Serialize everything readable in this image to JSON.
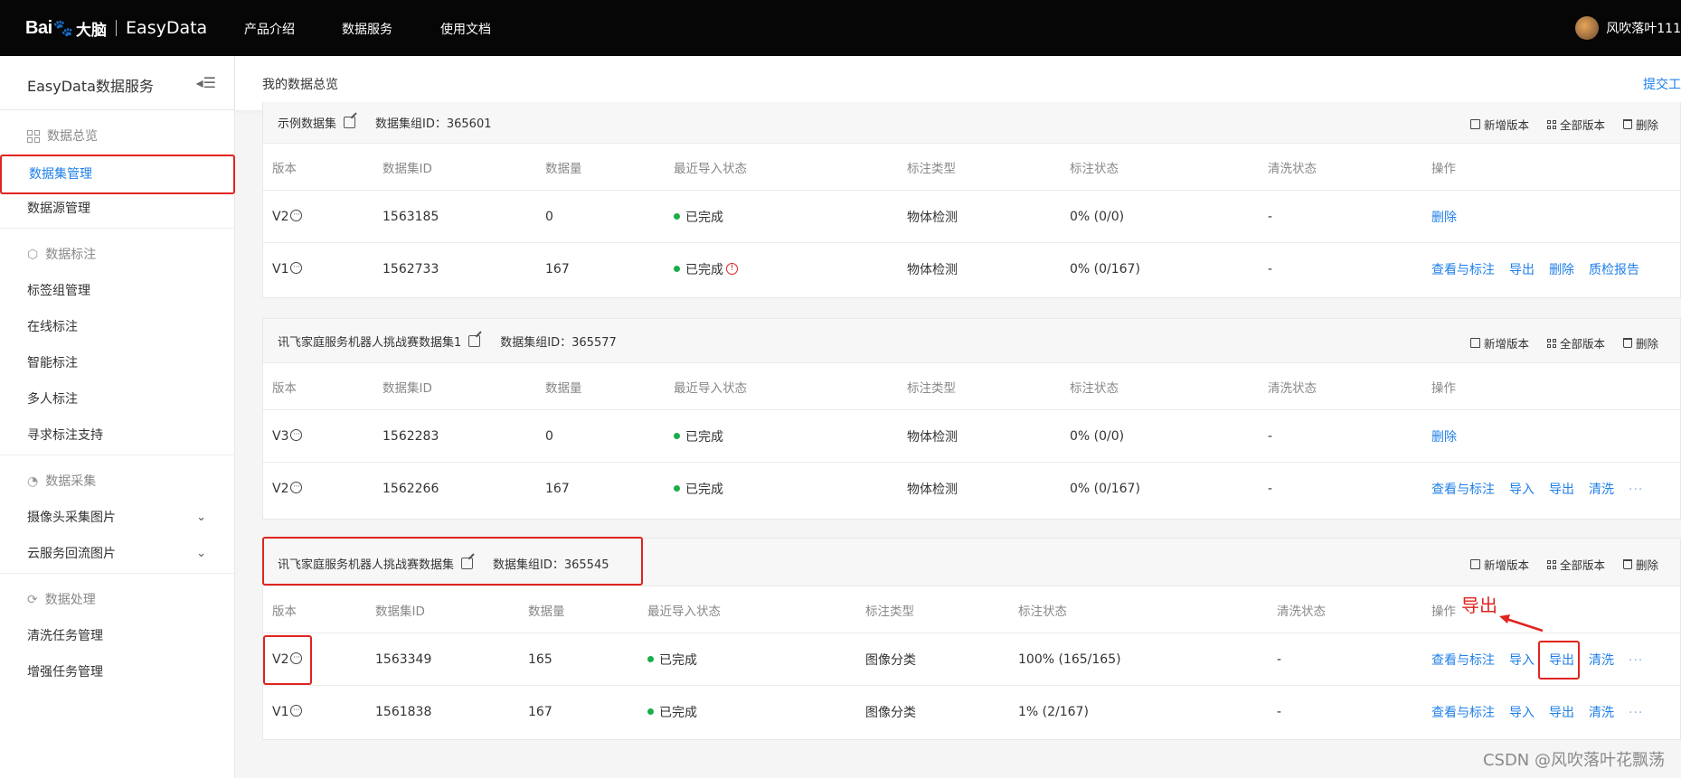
{
  "topnav": {
    "logo_bai": "Bai",
    "logo_paw": "🐾",
    "logo_brain": "大脑",
    "logo_easydata": "EasyData",
    "links": [
      "产品介绍",
      "数据服务",
      "使用文档"
    ],
    "username": "风吹落叶111"
  },
  "sidebar": {
    "title": "EasyData数据服务",
    "groups": {
      "overview": "数据总览",
      "labeling": "数据标注",
      "collection": "数据采集",
      "processing": "数据处理"
    },
    "items": {
      "dataset_mgmt": "数据集管理",
      "datasource_mgmt": "数据源管理",
      "tag_group": "标签组管理",
      "online_label": "在线标注",
      "smart_label": "智能标注",
      "multi_label": "多人标注",
      "label_support": "寻求标注支持",
      "camera_images": "摄像头采集图片",
      "cloud_images": "云服务回流图片",
      "clean_tasks": "清洗任务管理",
      "augment_tasks": "增强任务管理"
    }
  },
  "header": {
    "breadcrumb": "我的数据总览",
    "submit": "提交工"
  },
  "panel_actions": {
    "new_version": "新增版本",
    "all_versions": "全部版本",
    "delete": "删除"
  },
  "columns": [
    "版本",
    "数据集ID",
    "数据量",
    "最近导入状态",
    "标注类型",
    "标注状态",
    "清洗状态",
    "操作"
  ],
  "datasets": [
    {
      "name": "示例数据集",
      "group_id_label": "数据集组ID：365601",
      "rows": [
        {
          "version": "V2",
          "id": "1563185",
          "count": "0",
          "status": "已完成",
          "type": "物体检测",
          "label_status": "0% (0/0)",
          "clean": "-",
          "ops": [
            "删除"
          ]
        },
        {
          "version": "V1",
          "id": "1562733",
          "count": "167",
          "status": "已完成",
          "type": "物体检测",
          "label_status": "0% (0/167)",
          "clean": "-",
          "ops": [
            "查看与标注",
            "导出",
            "删除",
            "质检报告"
          ]
        }
      ]
    },
    {
      "name": "讯飞家庭服务机器人挑战赛数据集1",
      "group_id_label": "数据集组ID：365577",
      "rows": [
        {
          "version": "V3",
          "id": "1562283",
          "count": "0",
          "status": "已完成",
          "type": "物体检测",
          "label_status": "0% (0/0)",
          "clean": "-",
          "ops": [
            "删除"
          ]
        },
        {
          "version": "V2",
          "id": "1562266",
          "count": "167",
          "status": "已完成",
          "type": "物体检测",
          "label_status": "0% (0/167)",
          "clean": "-",
          "ops": [
            "查看与标注",
            "导入",
            "导出",
            "清洗",
            "···"
          ]
        }
      ]
    },
    {
      "name": "讯飞家庭服务机器人挑战赛数据集",
      "group_id_label": "数据集组ID：365545",
      "rows": [
        {
          "version": "V2",
          "id": "1563349",
          "count": "165",
          "status": "已完成",
          "type": "图像分类",
          "label_status": "100% (165/165)",
          "clean": "-",
          "ops": [
            "查看与标注",
            "导入",
            "导出",
            "清洗",
            "···"
          ]
        },
        {
          "version": "V1",
          "id": "1561838",
          "count": "167",
          "status": "已完成",
          "type": "图像分类",
          "label_status": "1% (2/167)",
          "clean": "-",
          "ops": [
            "查看与标注",
            "导入",
            "导出",
            "清洗",
            "···"
          ]
        }
      ]
    }
  ],
  "annotation": {
    "export_note": "导出"
  },
  "watermark": "CSDN @风吹落叶花飘荡",
  "colors": {
    "accent": "#2080e8",
    "highlight": "#e0241f",
    "success": "#1aad4b",
    "topnav_bg": "#060606"
  }
}
